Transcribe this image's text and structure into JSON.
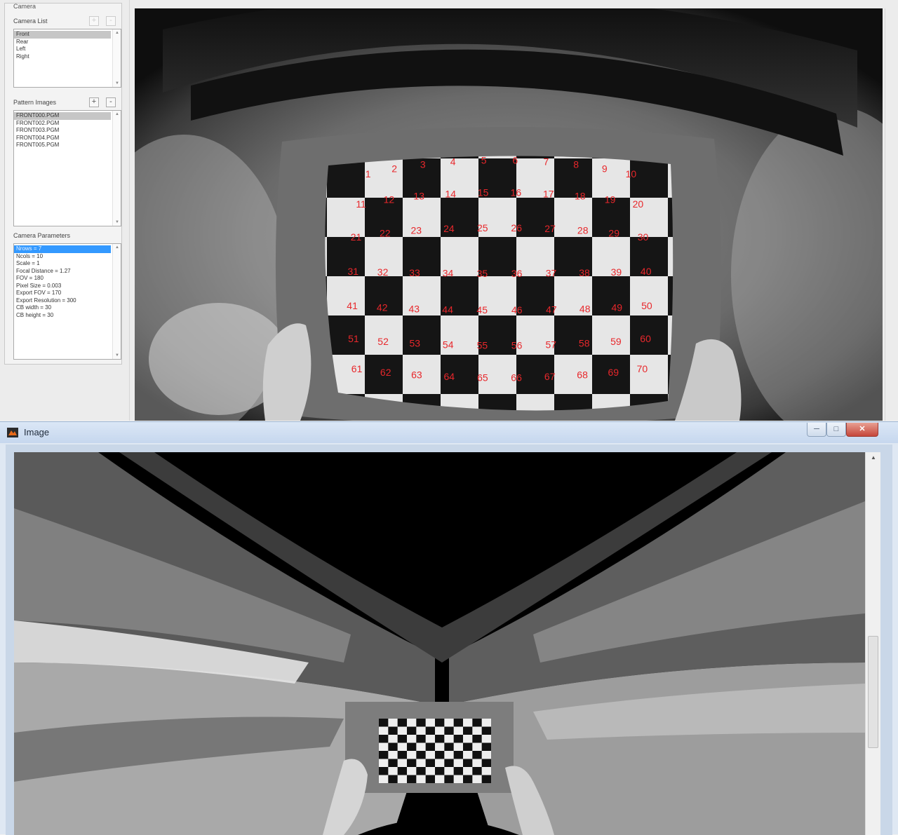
{
  "calibration_panel": {
    "group_label": "Camera",
    "camera_list": {
      "label": "Camera List",
      "add_button": "+",
      "remove_button": "-",
      "items": [
        "Front",
        "Rear",
        "Left",
        "Right"
      ]
    },
    "pattern_images": {
      "label": "Pattern Images",
      "add_button": "+",
      "remove_button": "-",
      "items": [
        "FRONT000.PGM",
        "FRONT002.PGM",
        "FRONT003.PGM",
        "FRONT004.PGM",
        "FRONT005.PGM"
      ]
    },
    "camera_parameters": {
      "label": "Camera Parameters",
      "items": [
        "Nrows = 7",
        "Ncols = 10",
        "Scale = 1",
        "Focal Distance = 1.27",
        "FOV = 180",
        "Pixel Size = 0.003",
        "Export FOV = 170",
        "Export Resolution = 300",
        "CB width = 30",
        "CB height = 30"
      ]
    }
  },
  "camera_view": {
    "corner_labels": [
      "1",
      "2",
      "3",
      "4",
      "5",
      "6",
      "7",
      "8",
      "9",
      "10",
      "11",
      "12",
      "13",
      "14",
      "15",
      "16",
      "17",
      "18",
      "19",
      "20",
      "21",
      "22",
      "23",
      "24",
      "25",
      "26",
      "27",
      "28",
      "29",
      "30",
      "31",
      "32",
      "33",
      "34",
      "35",
      "36",
      "37",
      "38",
      "39",
      "40",
      "41",
      "42",
      "43",
      "44",
      "45",
      "46",
      "47",
      "48",
      "49",
      "50",
      "51",
      "52",
      "53",
      "54",
      "55",
      "56",
      "57",
      "58",
      "59",
      "60",
      "61",
      "62",
      "63",
      "64",
      "65",
      "66",
      "67",
      "68",
      "69",
      "70"
    ],
    "label_color": "#e8272b"
  },
  "image_window": {
    "title": "Image",
    "minimize_label": "─",
    "maximize_label": "□",
    "close_label": "✕",
    "scroll_up_label": "▲"
  }
}
